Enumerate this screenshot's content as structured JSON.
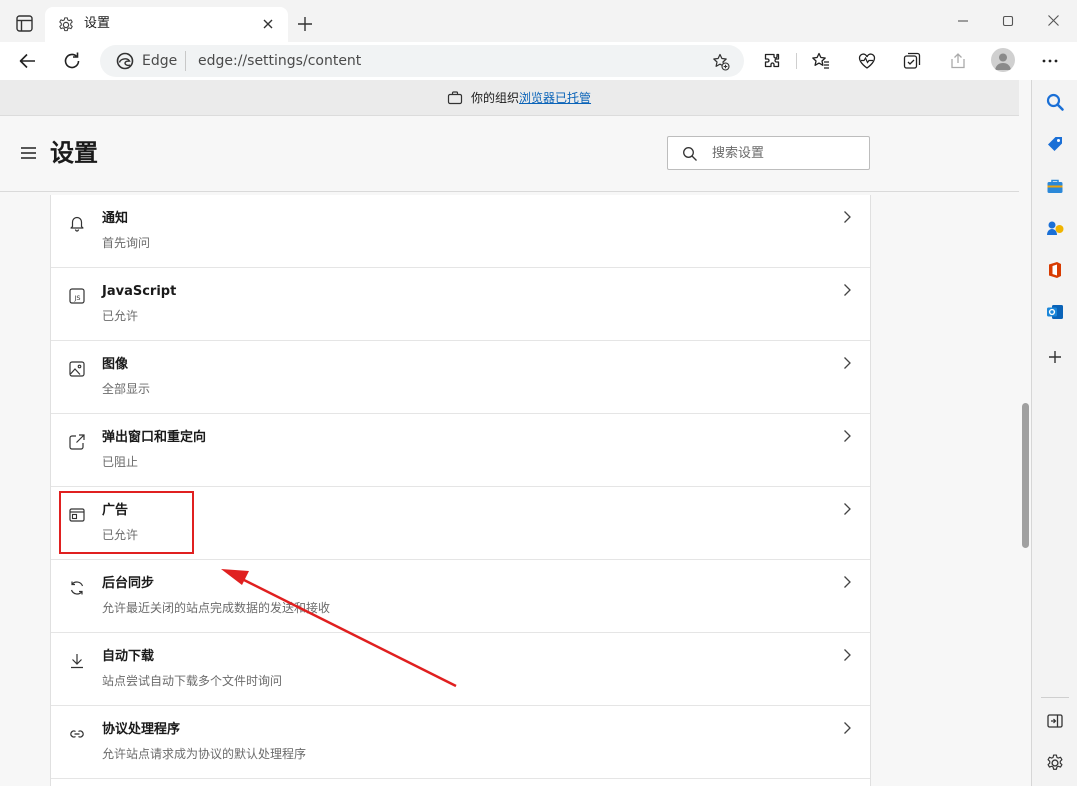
{
  "tab": {
    "title": "设置"
  },
  "address": {
    "site_label": "Edge",
    "url": "edge://settings/content"
  },
  "managed_bar": {
    "prefix": "你的组织",
    "link": "浏览器已托管"
  },
  "header": {
    "title": "设置",
    "search_placeholder": "搜索设置"
  },
  "rows": [
    {
      "title": "通知",
      "subtitle": "首先询问",
      "icon": "bell-icon"
    },
    {
      "title": "JavaScript",
      "subtitle": "已允许",
      "icon": "js-icon"
    },
    {
      "title": "图像",
      "subtitle": "全部显示",
      "icon": "image-icon"
    },
    {
      "title": "弹出窗口和重定向",
      "subtitle": "已阻止",
      "icon": "popup-icon"
    },
    {
      "title": "广告",
      "subtitle": "已允许",
      "icon": "ads-icon"
    },
    {
      "title": "后台同步",
      "subtitle": "允许最近关闭的站点完成数据的发送和接收",
      "icon": "sync-icon"
    },
    {
      "title": "自动下载",
      "subtitle": "站点尝试自动下载多个文件时询问",
      "icon": "download-icon"
    },
    {
      "title": "协议处理程序",
      "subtitle": "允许站点请求成为协议的默认处理程序",
      "icon": "protocol-icon"
    }
  ],
  "colors": {
    "accent": "#0a63b8",
    "annotation": "#e02020"
  }
}
